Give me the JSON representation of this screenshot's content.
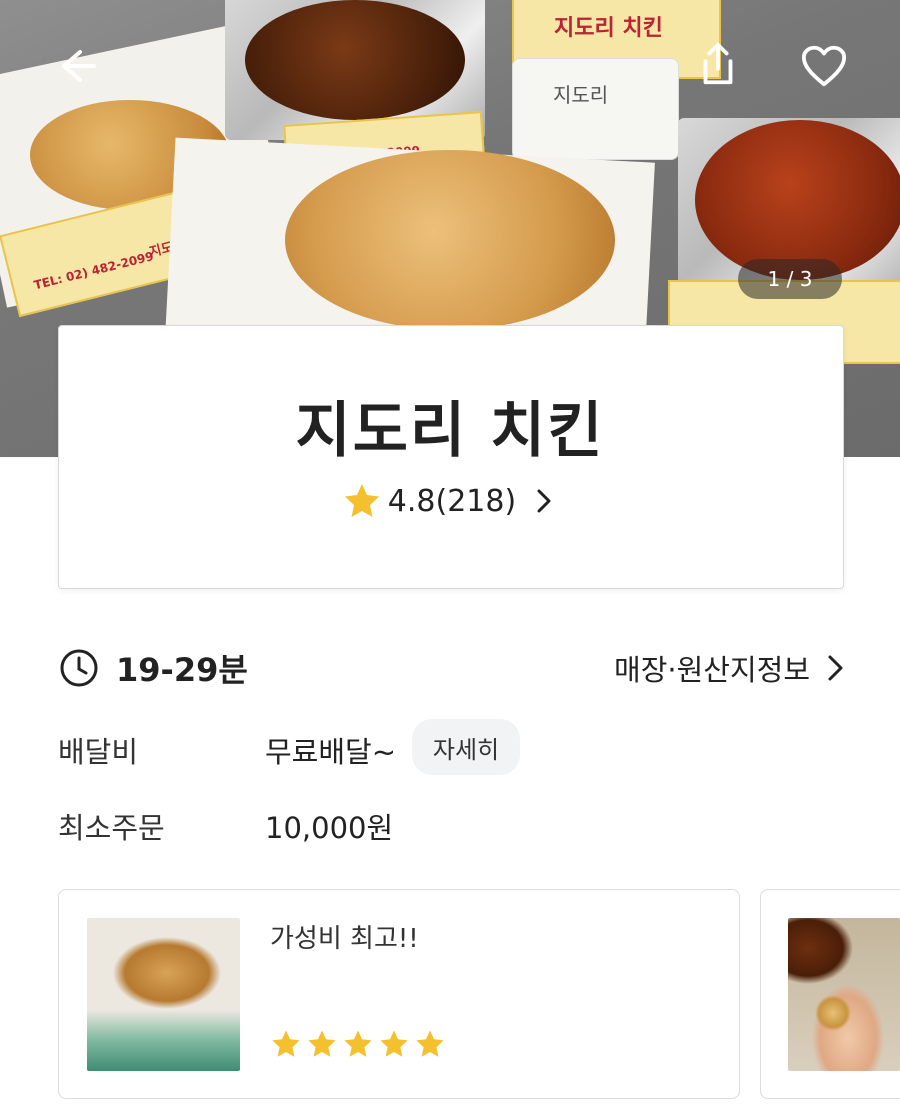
{
  "hero": {
    "image_counter": "1 / 3",
    "box_text_1": "지도리 치킨",
    "box_text_2": "지도리 치킨",
    "phone_1": "TEL: 02) 482-2099",
    "phone_2": "TEL: 02) 482-2099",
    "sauce_label": "지도리"
  },
  "icons": {
    "back": "back-arrow-icon",
    "share": "share-icon",
    "favorite": "heart-icon",
    "rating_star": "star-icon",
    "clock": "clock-icon",
    "chevron": "chevron-right-icon"
  },
  "store": {
    "name": "지도리 치킨",
    "rating": "4.8(218)"
  },
  "delivery": {
    "time": "19-29분",
    "store_info_link": "매장·원산지정보",
    "fee_label": "배달비",
    "fee_value": "무료배달~",
    "fee_detail_button": "자세히",
    "min_order_label": "최소주문",
    "min_order_value": "10,000원"
  },
  "reviews": [
    {
      "text": "가성비 최고!!",
      "stars": 5
    }
  ],
  "colors": {
    "star": "#F5C02D",
    "text": "#222222",
    "chip_bg": "#F2F3F5"
  }
}
